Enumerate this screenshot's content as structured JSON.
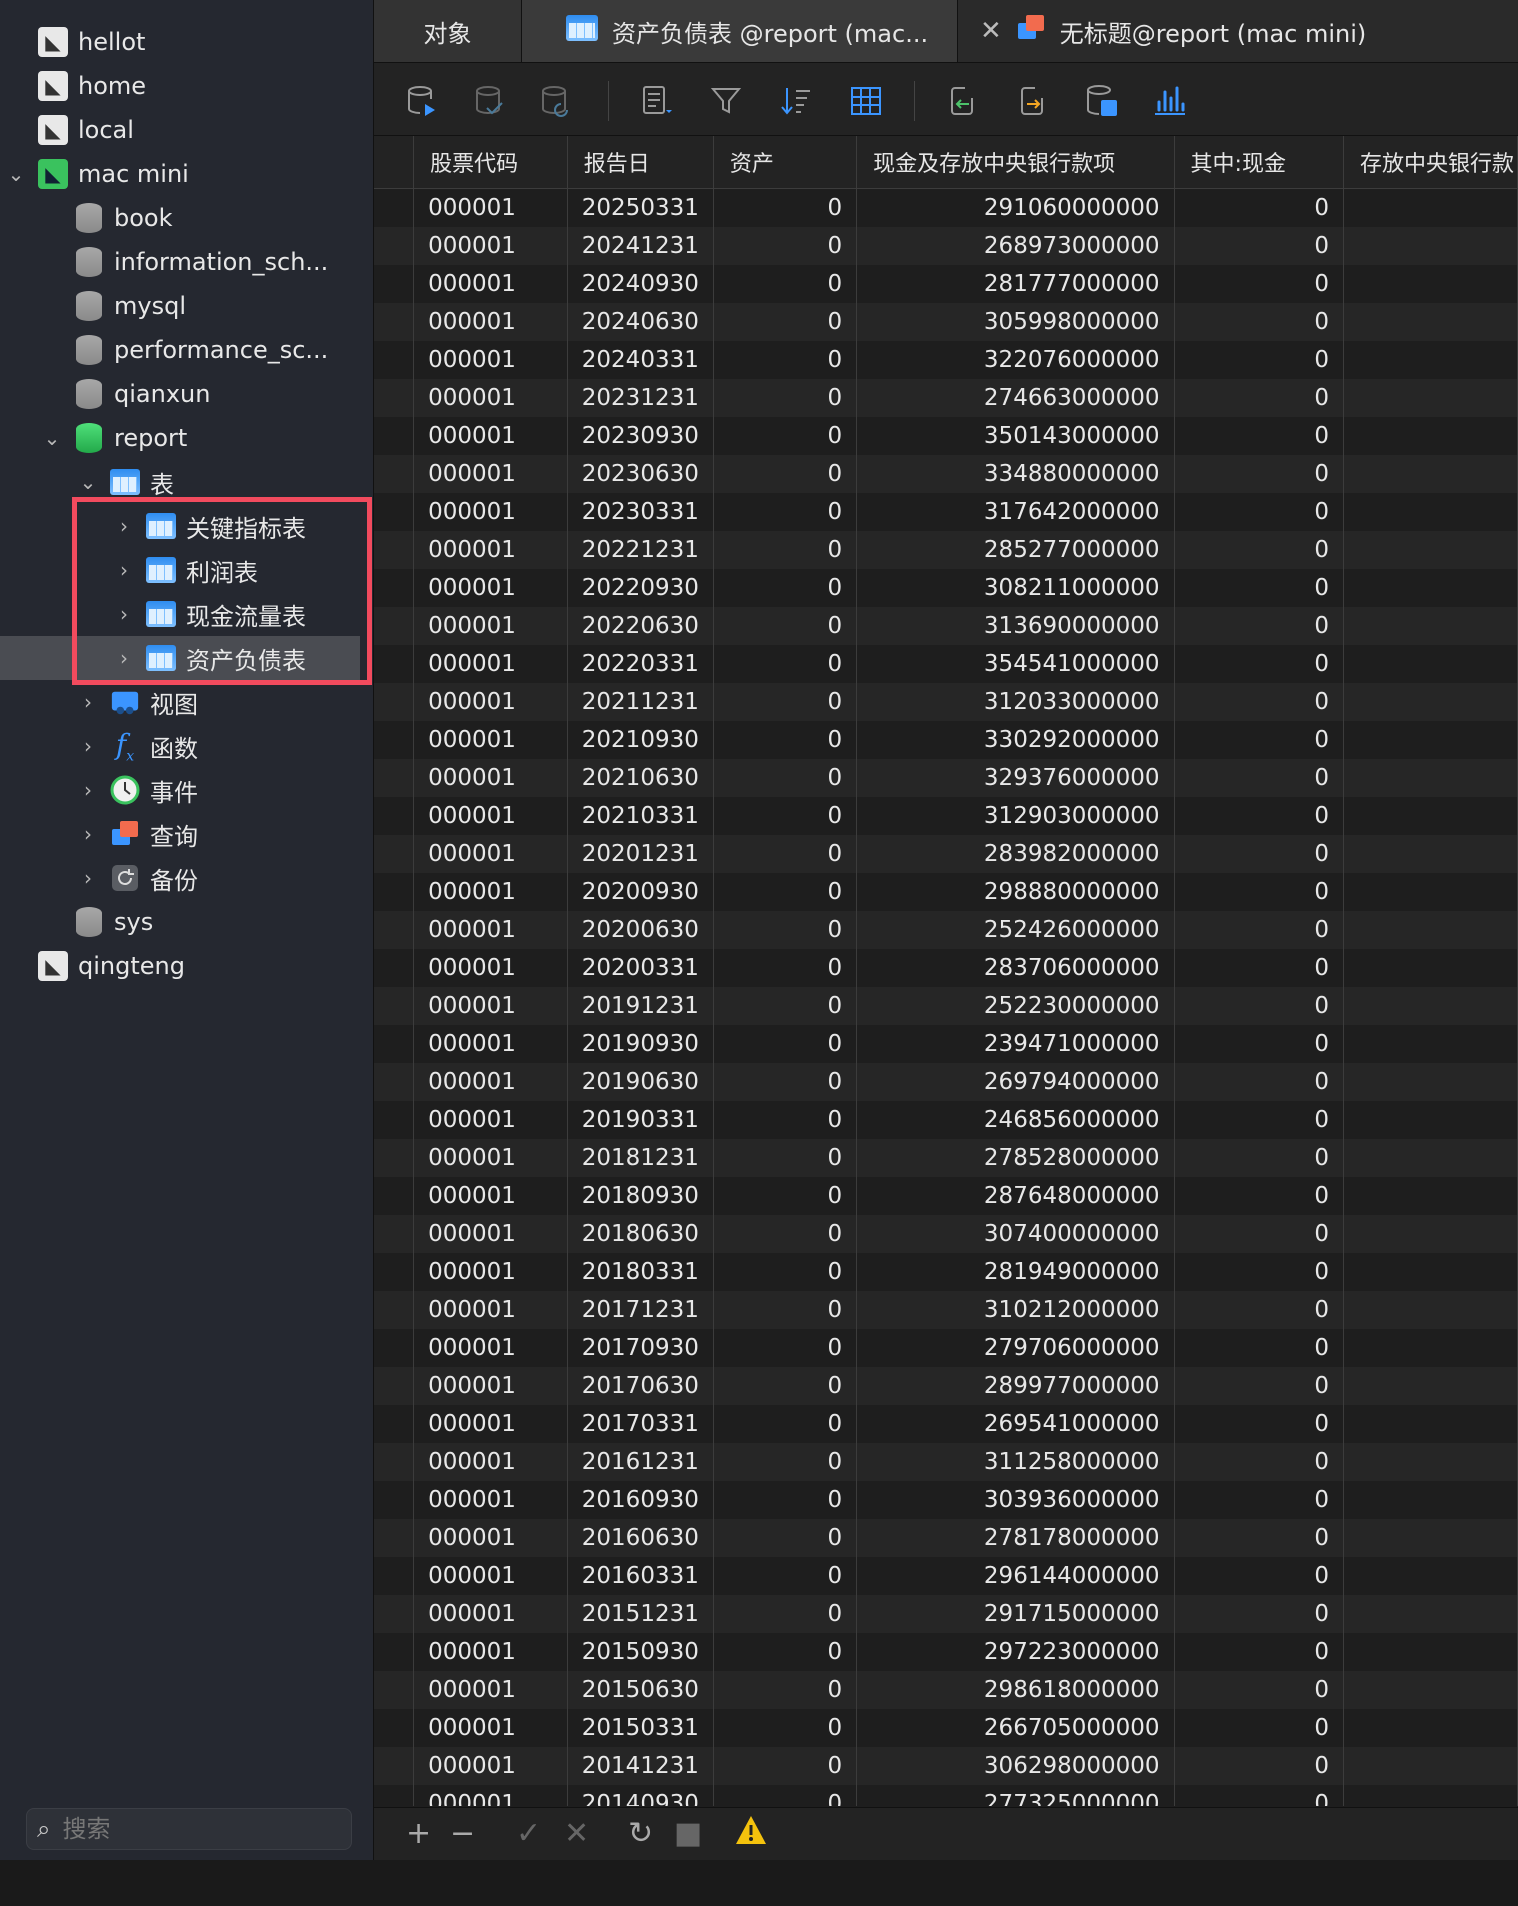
{
  "sidebar": {
    "items": [
      {
        "label": "hellot",
        "type": "connection",
        "indent": 0
      },
      {
        "label": "home",
        "type": "connection",
        "indent": 0
      },
      {
        "label": "local",
        "type": "connection",
        "indent": 0
      },
      {
        "label": "mac mini",
        "type": "connection-active",
        "indent": 0,
        "expanded": true
      },
      {
        "label": "book",
        "type": "database",
        "indent": 1
      },
      {
        "label": "information_sch...",
        "type": "database",
        "indent": 1
      },
      {
        "label": "mysql",
        "type": "database",
        "indent": 1
      },
      {
        "label": "performance_sc...",
        "type": "database",
        "indent": 1
      },
      {
        "label": "qianxun",
        "type": "database",
        "indent": 1
      },
      {
        "label": "report",
        "type": "database-active",
        "indent": 1,
        "expanded": true
      },
      {
        "label": "表",
        "type": "tables-group",
        "indent": 2,
        "expanded": true
      },
      {
        "label": "关键指标表",
        "type": "table",
        "indent": 3
      },
      {
        "label": "利润表",
        "type": "table",
        "indent": 3
      },
      {
        "label": "现金流量表",
        "type": "table",
        "indent": 3
      },
      {
        "label": "资产负债表",
        "type": "table",
        "indent": 3,
        "selected": true
      },
      {
        "label": "视图",
        "type": "views",
        "indent": 2
      },
      {
        "label": "函数",
        "type": "functions",
        "indent": 2
      },
      {
        "label": "事件",
        "type": "events",
        "indent": 2
      },
      {
        "label": "查询",
        "type": "queries",
        "indent": 2
      },
      {
        "label": "备份",
        "type": "backups",
        "indent": 2
      },
      {
        "label": "sys",
        "type": "database",
        "indent": 1
      },
      {
        "label": "qingteng",
        "type": "connection",
        "indent": 0
      }
    ],
    "search_placeholder": "搜索"
  },
  "tabs": {
    "objects": "对象",
    "active": "资产负债表 @report (mac...",
    "third": "无标题@report (mac mini)"
  },
  "grid": {
    "columns": [
      "股票代码",
      "报告日",
      "资产",
      "现金及存放中央银行款项",
      "其中:现金",
      "存放中央银行款"
    ],
    "rows": [
      [
        "000001",
        "20250331",
        "0",
        "291060000000",
        "0"
      ],
      [
        "000001",
        "20241231",
        "0",
        "268973000000",
        "0"
      ],
      [
        "000001",
        "20240930",
        "0",
        "281777000000",
        "0"
      ],
      [
        "000001",
        "20240630",
        "0",
        "305998000000",
        "0"
      ],
      [
        "000001",
        "20240331",
        "0",
        "322076000000",
        "0"
      ],
      [
        "000001",
        "20231231",
        "0",
        "274663000000",
        "0"
      ],
      [
        "000001",
        "20230930",
        "0",
        "350143000000",
        "0"
      ],
      [
        "000001",
        "20230630",
        "0",
        "334880000000",
        "0"
      ],
      [
        "000001",
        "20230331",
        "0",
        "317642000000",
        "0"
      ],
      [
        "000001",
        "20221231",
        "0",
        "285277000000",
        "0"
      ],
      [
        "000001",
        "20220930",
        "0",
        "308211000000",
        "0"
      ],
      [
        "000001",
        "20220630",
        "0",
        "313690000000",
        "0"
      ],
      [
        "000001",
        "20220331",
        "0",
        "354541000000",
        "0"
      ],
      [
        "000001",
        "20211231",
        "0",
        "312033000000",
        "0"
      ],
      [
        "000001",
        "20210930",
        "0",
        "330292000000",
        "0"
      ],
      [
        "000001",
        "20210630",
        "0",
        "329376000000",
        "0"
      ],
      [
        "000001",
        "20210331",
        "0",
        "312903000000",
        "0"
      ],
      [
        "000001",
        "20201231",
        "0",
        "283982000000",
        "0"
      ],
      [
        "000001",
        "20200930",
        "0",
        "298880000000",
        "0"
      ],
      [
        "000001",
        "20200630",
        "0",
        "252426000000",
        "0"
      ],
      [
        "000001",
        "20200331",
        "0",
        "283706000000",
        "0"
      ],
      [
        "000001",
        "20191231",
        "0",
        "252230000000",
        "0"
      ],
      [
        "000001",
        "20190930",
        "0",
        "239471000000",
        "0"
      ],
      [
        "000001",
        "20190630",
        "0",
        "269794000000",
        "0"
      ],
      [
        "000001",
        "20190331",
        "0",
        "246856000000",
        "0"
      ],
      [
        "000001",
        "20181231",
        "0",
        "278528000000",
        "0"
      ],
      [
        "000001",
        "20180930",
        "0",
        "287648000000",
        "0"
      ],
      [
        "000001",
        "20180630",
        "0",
        "307400000000",
        "0"
      ],
      [
        "000001",
        "20180331",
        "0",
        "281949000000",
        "0"
      ],
      [
        "000001",
        "20171231",
        "0",
        "310212000000",
        "0"
      ],
      [
        "000001",
        "20170930",
        "0",
        "279706000000",
        "0"
      ],
      [
        "000001",
        "20170630",
        "0",
        "289977000000",
        "0"
      ],
      [
        "000001",
        "20170331",
        "0",
        "269541000000",
        "0"
      ],
      [
        "000001",
        "20161231",
        "0",
        "311258000000",
        "0"
      ],
      [
        "000001",
        "20160930",
        "0",
        "303936000000",
        "0"
      ],
      [
        "000001",
        "20160630",
        "0",
        "278178000000",
        "0"
      ],
      [
        "000001",
        "20160331",
        "0",
        "296144000000",
        "0"
      ],
      [
        "000001",
        "20151231",
        "0",
        "291715000000",
        "0"
      ],
      [
        "000001",
        "20150930",
        "0",
        "297223000000",
        "0"
      ],
      [
        "000001",
        "20150630",
        "0",
        "298618000000",
        "0"
      ],
      [
        "000001",
        "20150331",
        "0",
        "266705000000",
        "0"
      ],
      [
        "000001",
        "20141231",
        "0",
        "306298000000",
        "0"
      ],
      [
        "000001",
        "20140930",
        "0",
        "277325000000",
        "0"
      ]
    ]
  },
  "colors": {
    "highlight": "#f24b5e",
    "connection_active": "#3ac25e",
    "accent_blue": "#3b95ff",
    "warning": "#f4a623"
  }
}
